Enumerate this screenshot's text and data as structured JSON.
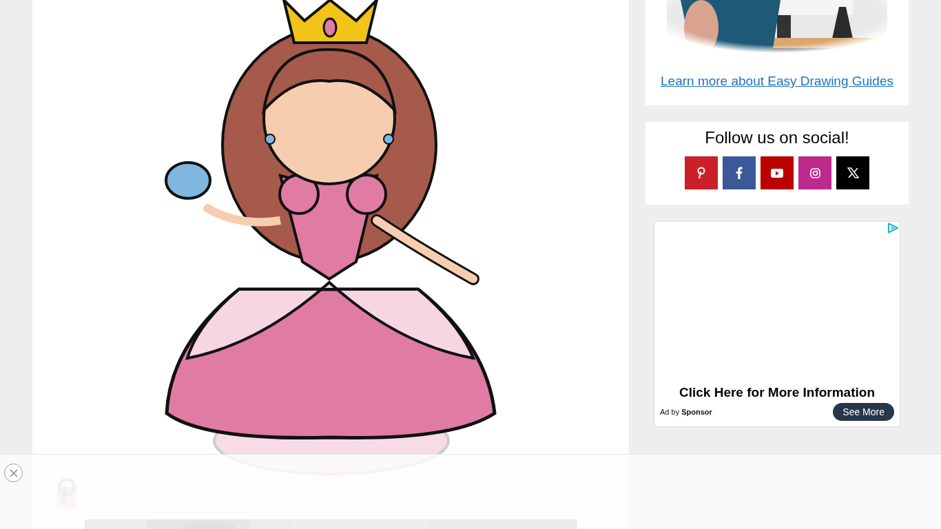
{
  "about": {
    "link": "Learn more about Easy Drawing Guides"
  },
  "social": {
    "title": "Follow us on social!",
    "buttons": [
      {
        "kind": "pinterest",
        "color": "#cb2027"
      },
      {
        "kind": "facebook",
        "color": "#3b5998"
      },
      {
        "kind": "youtube",
        "color": "#bb0000"
      },
      {
        "kind": "instagram",
        "color": "#bc2a8d"
      },
      {
        "kind": "x",
        "color": "#000000"
      }
    ]
  },
  "ad": {
    "headline": "Click Here for More Information",
    "byline": "Ad by **Sponsor**",
    "button": "See More"
  }
}
